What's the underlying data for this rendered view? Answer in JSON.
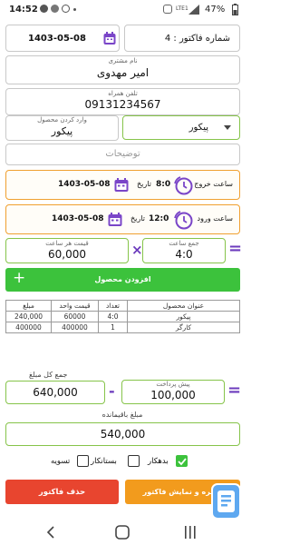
{
  "status_bar": {
    "time": "14:52",
    "battery": "47%",
    "network": "LTE1"
  },
  "invoice": {
    "date": "1403-05-08",
    "number_label": "شماره فاکتور : 4"
  },
  "customer": {
    "name_label": "نام مشتری",
    "name_value": "امیر مهدوی"
  },
  "phone": {
    "label": "تلفن همراه",
    "value": "09131234567"
  },
  "product_input": {
    "label": "وارد کردن محصول",
    "value": "پیکور",
    "dropdown_value": "پیکور"
  },
  "description": {
    "placeholder": "توضیحات"
  },
  "exit_time": {
    "label": "ساعت خروج",
    "time": "8:0",
    "date_label": "تاریخ",
    "date": "1403-05-08"
  },
  "entry_time": {
    "label": "ساعت ورود",
    "time": "12:0",
    "date_label": "تاریخ",
    "date": "1403-05-08"
  },
  "calc": {
    "hours_label": "جمع ساعت",
    "hours_value": "4:0",
    "rate_label": "قیمت هر ساعت",
    "rate_value": "60,000",
    "multiply": "×",
    "equals": "="
  },
  "add_button": {
    "plus": "+",
    "label": "افزودن محصول"
  },
  "table": {
    "headers": [
      "عنوان محصول",
      "تعداد",
      "قیمت واحد",
      "مبلغ"
    ],
    "rows": [
      [
        "پیکور",
        "4:0",
        "60000",
        "240,000"
      ],
      [
        "کارگر",
        "1",
        "400000",
        "400000"
      ]
    ]
  },
  "totals": {
    "total_label": "جمع کل مبلغ",
    "total_value": "640,000",
    "prepay_label": "پیش پرداخت",
    "prepay_value": "100,000",
    "remaining_label": "مبلغ باقیمانده",
    "remaining_value": "540,000",
    "minus": "-",
    "equals": "="
  },
  "checks": {
    "debtor": "بدهکار",
    "creditor": "بستانکار",
    "settle": "تسویه",
    "debtor_checked": true
  },
  "actions": {
    "delete": "حذف فاکتور",
    "save": "ذخیره و نمایش فاکتور"
  },
  "colors": {
    "green": "#3cc23c",
    "purple": "#6c3bbd",
    "orange": "#f29b1d",
    "red": "#e8452f",
    "accent_border": "#86c44a"
  }
}
